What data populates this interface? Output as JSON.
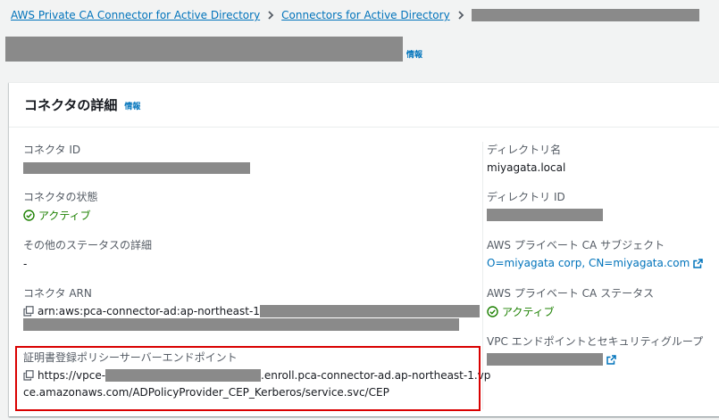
{
  "breadcrumb": {
    "item1": "AWS Private CA Connector for Active Directory",
    "item2": "Connectors for Active Directory"
  },
  "page": {
    "info_label": "情報"
  },
  "card": {
    "title": "コネクタの詳細",
    "info_label": "情報"
  },
  "left": {
    "connector_id_label": "コネクタ ID",
    "connector_status_label": "コネクタの状態",
    "connector_status_value": "アクティブ",
    "other_status_label": "その他のステータスの詳細",
    "other_status_value": "-",
    "arn_label": "コネクタ ARN",
    "arn_prefix": "arn:aws:pca-connector-ad:ap-northeast-1",
    "endpoint_label": "証明書登録ポリシーサーバーエンドポイント",
    "endpoint_prefix": "https://vpce-",
    "endpoint_suffix": ".enroll.pca-connector-ad.ap-northeast-1.vp",
    "endpoint_line2": "ce.amazonaws.com/ADPolicyProvider_CEP_Kerberos/service.svc/CEP"
  },
  "right": {
    "directory_name_label": "ディレクトリ名",
    "directory_name_value": "miyagata.local",
    "directory_id_label": "ディレクトリ ID",
    "ca_subject_label": "AWS プライベート CA サブジェクト",
    "ca_subject_value": "O=miyagata corp, CN=miyagata.com",
    "ca_status_label": "AWS プライベート CA ステータス",
    "ca_status_value": "アクティブ",
    "vpc_label": "VPC エンドポイントとセキュリティグループ"
  },
  "colors": {
    "link": "#0073bb",
    "success": "#1d8102",
    "highlight": "#d90000",
    "redaction": "#8a8a8a"
  }
}
